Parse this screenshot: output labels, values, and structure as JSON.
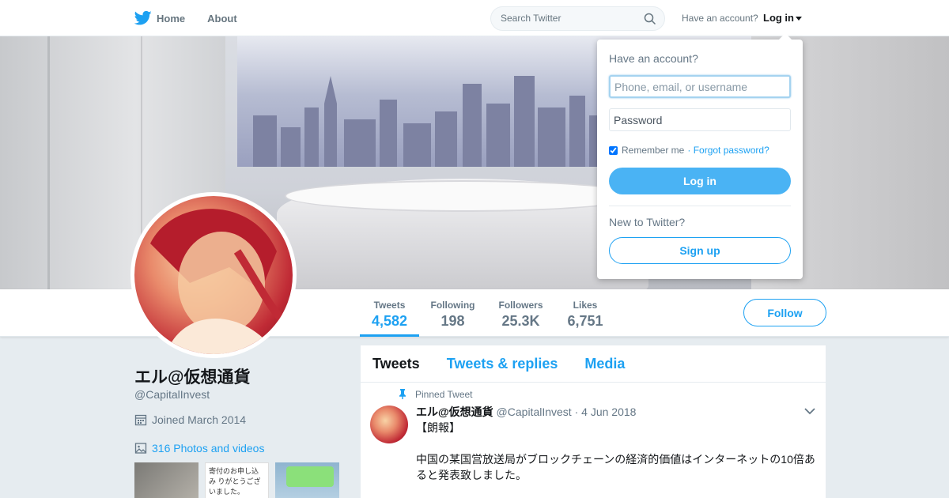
{
  "nav": {
    "home_label": "Home",
    "about_label": "About",
    "search_placeholder": "Search Twitter",
    "have_account_label": "Have an account?",
    "login_label": "Log in"
  },
  "profile": {
    "name": "エル@仮想通貨",
    "handle": "@CapitalInvest",
    "joined": "Joined March 2014",
    "photos_link": "316 Photos and videos",
    "follow_label": "Follow",
    "stats": [
      {
        "label": "Tweets",
        "value": "4,582"
      },
      {
        "label": "Following",
        "value": "198"
      },
      {
        "label": "Followers",
        "value": "25.3K"
      },
      {
        "label": "Likes",
        "value": "6,751"
      }
    ],
    "thumbnails": [
      {
        "text": ""
      },
      {
        "text": "寄付のお申し込み りがとうございました。"
      },
      {
        "text": ""
      }
    ]
  },
  "timeline": {
    "tabs": [
      "Tweets",
      "Tweets & replies",
      "Media"
    ],
    "pinned_label": "Pinned Tweet",
    "tweet": {
      "author": "エル@仮想通貨",
      "handle": "@CapitalInvest",
      "date": "· 4 Jun 2018",
      "line1": "【朗報】",
      "line2": "中国の某国営放送局がブロックチェーンの経済的価値はインターネットの10倍あると発表致しました。"
    }
  },
  "login_dropdown": {
    "title": "Have an account?",
    "username_placeholder": "Phone, email, or username",
    "password_placeholder": "Password",
    "remember_label": "Remember me",
    "forgot_label": "· Forgot password?",
    "login_button": "Log in",
    "new_label": "New to Twitter?",
    "signup_button": "Sign up"
  },
  "colors": {
    "accent": "#1da1f2",
    "login_button": "#4ab3f4",
    "page_bg": "#e6ecf0"
  }
}
